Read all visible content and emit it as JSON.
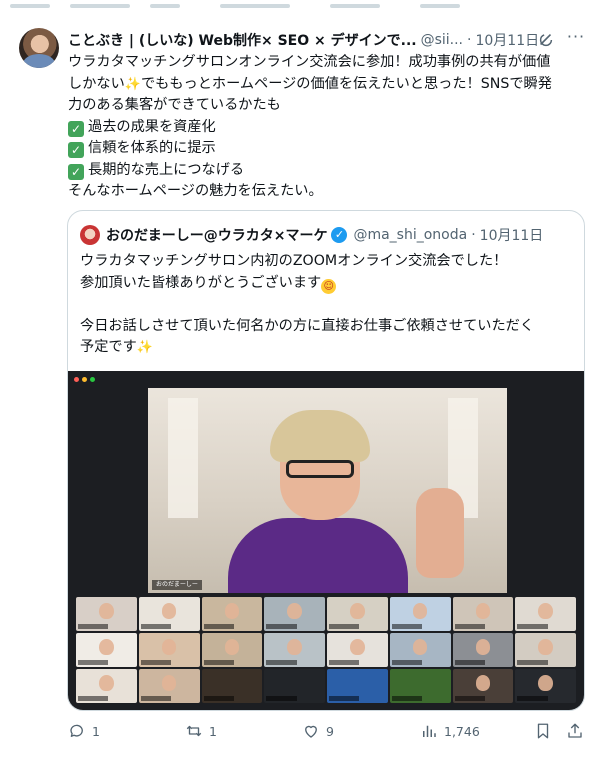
{
  "tweet": {
    "author": {
      "display_name": "ことぶき | (しいな) Web制作× SEO × デザインで...",
      "handle": "@sii...",
      "avatar_icon": "author-avatar"
    },
    "time": "10月11日",
    "separator": "·",
    "text_lines": [
      {
        "text": "ウラカタマッチングサロンオンライン交流会に参加！成功事例の共有が価値"
      },
      {
        "text": "しかない",
        "emoji": "✨",
        "after": "でももっとホームページの価値を伝えたいと思った！SNSで瞬発"
      },
      {
        "text": "力のある集客ができているかたも"
      },
      {
        "check": "✓",
        "text": "過去の成果を資産化"
      },
      {
        "check": "✓",
        "text": "信頼を体系的に提示"
      },
      {
        "check": "✓",
        "text": "長期的な売上につなげる"
      },
      {
        "text": "そんなホームページの魅力を伝えたい。"
      }
    ],
    "quoted": {
      "display_name": "おのだまーしー@ウラカタ×マーケ",
      "verified_icon": "verified-badge-icon",
      "handle": "@ma_shi_onoda",
      "separator": "·",
      "time": "10月11日",
      "text_lines": [
        {
          "text": "ウラカタマッチングサロン内初のZOOMオンライン交流会でした！"
        },
        {
          "text": "参加頂いた皆様ありがとうございます",
          "emoji": "☺"
        },
        {
          "text": ""
        },
        {
          "text": "今日お話しさせて頂いた何名かの方に直接お仕事ご依頼させていただく"
        },
        {
          "text": "予定です",
          "emoji": "✨"
        }
      ],
      "media": {
        "description_icon": "zoom-meeting-screenshot",
        "main_speaker_tag": "おのだまーしー",
        "thumbnail_count": 24
      }
    },
    "actions": {
      "replies": "1",
      "reposts": "1",
      "likes": "9",
      "views": "1,746"
    }
  },
  "colors": {
    "text_primary": "#0f1419",
    "text_secondary": "#536471",
    "border": "#cfd9de",
    "verified_blue": "#1d9bf0",
    "check_green": "#42a45a"
  }
}
